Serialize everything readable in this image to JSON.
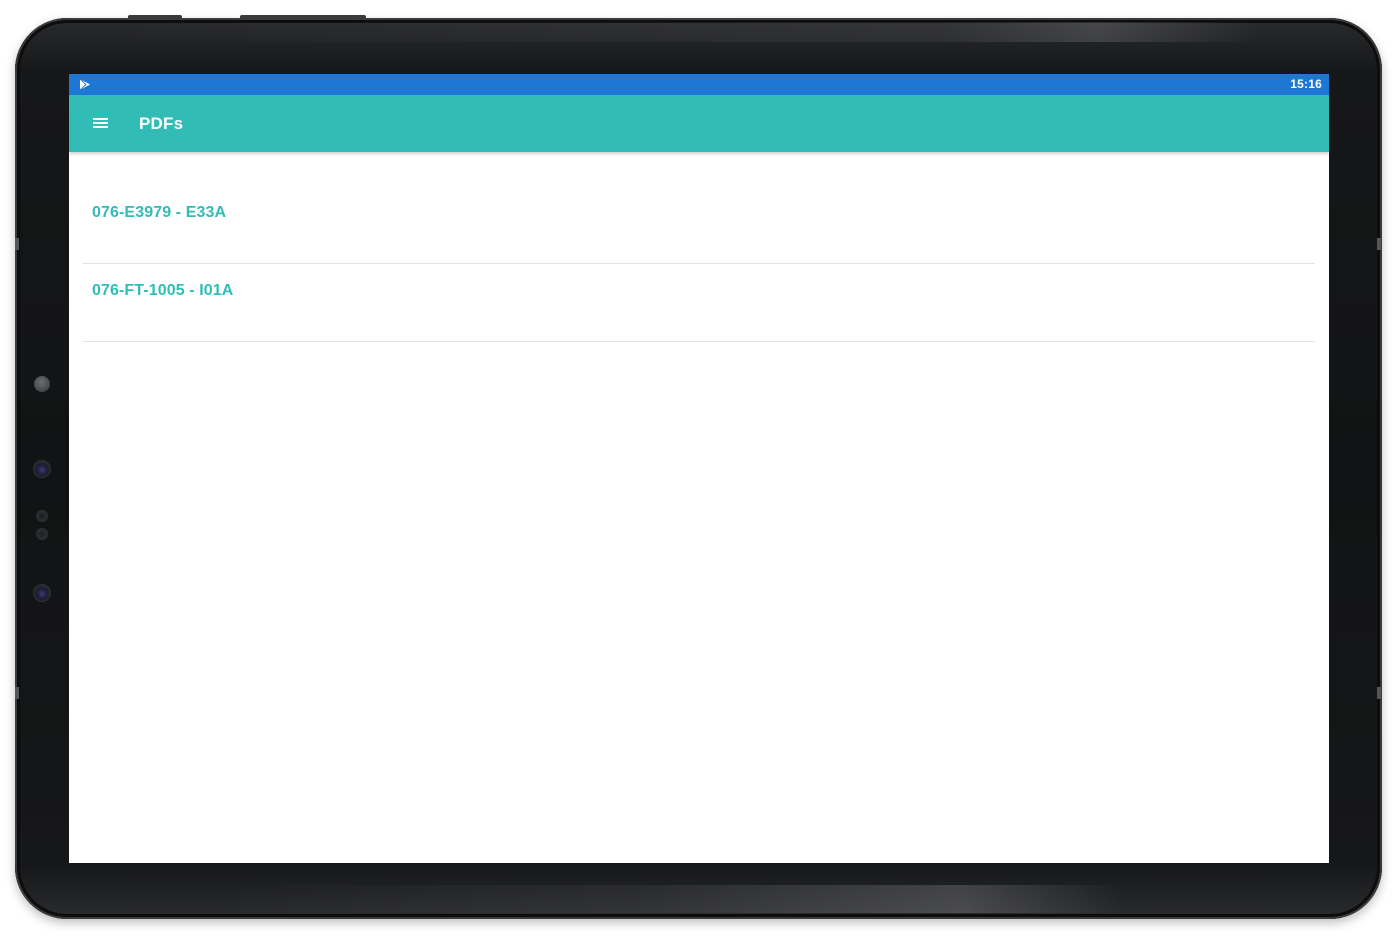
{
  "status_bar": {
    "time": "15:16",
    "left_icon": "play-store-icon",
    "color": "#1e77d4"
  },
  "app_bar": {
    "title": "PDFs",
    "menu_icon": "hamburger-menu-icon",
    "color": "#31bcb6"
  },
  "pdf_list": {
    "items": [
      {
        "label": "076-E3979 - E33A"
      },
      {
        "label": "076-FT-1005 - I01A"
      }
    ],
    "accent_color": "#31bcb6"
  }
}
